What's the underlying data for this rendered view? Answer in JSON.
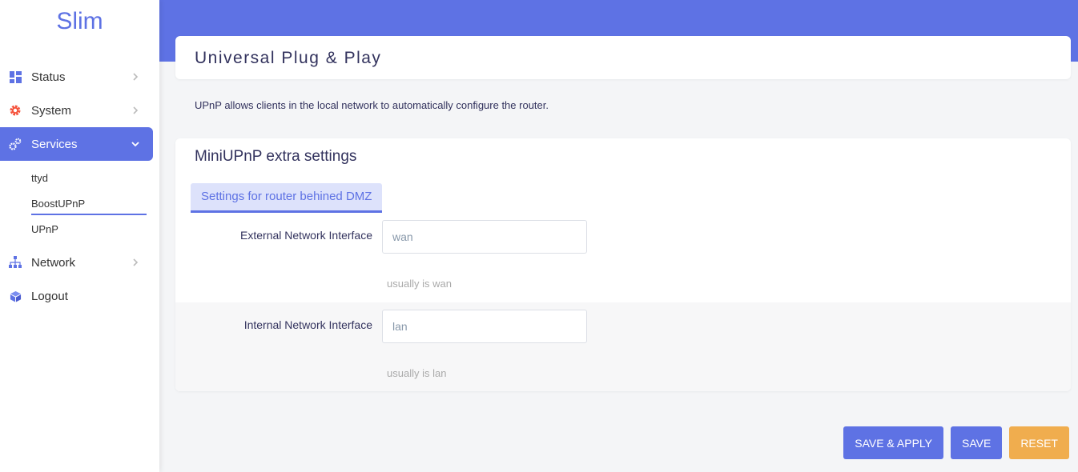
{
  "brand": "Slim",
  "nav": {
    "status": "Status",
    "system": "System",
    "services": "Services",
    "services_sub": [
      "ttyd",
      "BoostUPnP",
      "UPnP"
    ],
    "network": "Network",
    "logout": "Logout"
  },
  "page": {
    "title": "Universal Plug & Play",
    "description": "UPnP allows clients in the local network to automatically configure the router."
  },
  "section": {
    "title": "MiniUPnP extra settings",
    "tab": "Settings for router behined DMZ",
    "fields": [
      {
        "label": "External Network Interface",
        "value": "wan",
        "hint": "usually is wan"
      },
      {
        "label": "Internal Network Interface",
        "value": "lan",
        "hint": "usually is lan"
      }
    ]
  },
  "actions": {
    "save_apply": "SAVE & APPLY",
    "save": "SAVE",
    "reset": "RESET"
  },
  "colors": {
    "accent": "#5e72e4",
    "warning": "#f0ad4e",
    "system_icon": "#f5533d"
  },
  "icons": {
    "status": "dashboard-icon",
    "system": "gear-icon",
    "services": "gears-icon",
    "network": "sitemap-icon",
    "logout": "cube-icon"
  }
}
